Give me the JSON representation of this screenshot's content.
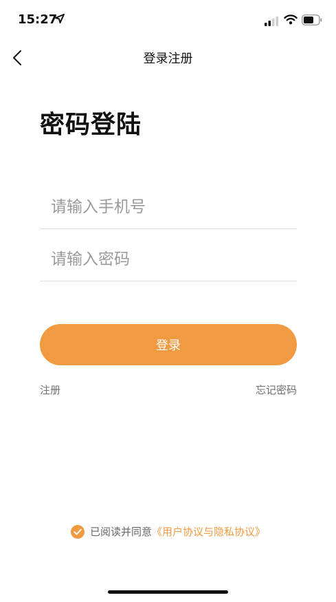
{
  "status": {
    "time": "15:27"
  },
  "nav": {
    "title": "登录注册"
  },
  "page": {
    "title": "密码登陆"
  },
  "form": {
    "phone_placeholder": "请输入手机号",
    "password_placeholder": "请输入密码",
    "login_label": "登录",
    "register_label": "注册",
    "forgot_label": "忘记密码"
  },
  "agreement": {
    "prefix": "已阅读并同意",
    "link_text": "《用户协议与隐私协议》",
    "checked": true
  },
  "colors": {
    "accent": "#f09a42",
    "text": "#111111",
    "muted": "#6f6f6f",
    "divider": "#dedede"
  },
  "icons": {
    "back": "chevron-left-icon",
    "location": "location-arrow-icon",
    "signal": "signal-icon",
    "wifi": "wifi-icon",
    "battery": "battery-icon",
    "check": "check-circle-icon"
  }
}
